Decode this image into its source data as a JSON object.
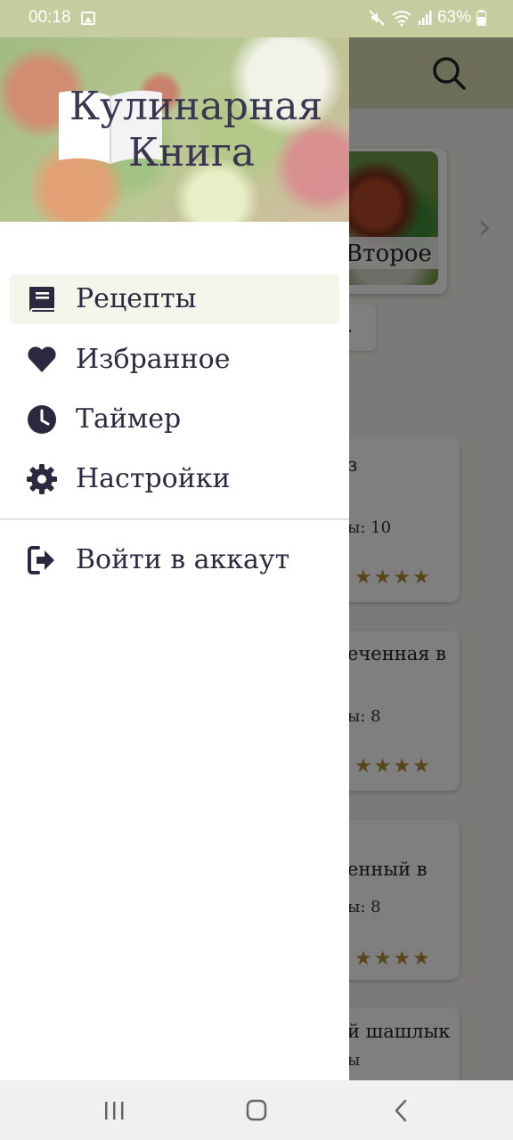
{
  "status_bar": {
    "time": "00:18",
    "battery": "63%",
    "icons": [
      "image-icon",
      "mute-icon",
      "wifi-icon",
      "signal-icon",
      "battery-icon"
    ]
  },
  "drawer": {
    "logo_line1": "Кулинарная",
    "logo_line2": "Книга",
    "items": [
      {
        "label": "Рецепты",
        "icon": "book-icon",
        "active": true
      },
      {
        "label": "Избранное",
        "icon": "heart-icon",
        "active": false
      },
      {
        "label": "Таймер",
        "icon": "clock-icon",
        "active": false
      },
      {
        "label": "Настройки",
        "icon": "gear-icon",
        "active": false
      }
    ],
    "login": {
      "label": "Войти в аккаут",
      "icon": "sign-in-icon"
    }
  },
  "background": {
    "category_label": "Второе",
    "ellipsis": ".",
    "recipes": [
      {
        "title": "з",
        "servings": "ы: 10",
        "stars": "★★★★"
      },
      {
        "title": "еченная в",
        "servings": "ы: 8",
        "stars": "★★★★"
      },
      {
        "title": "енный в",
        "servings": "ы: 8",
        "stars": "★★★★"
      },
      {
        "title": "й шашлык",
        "servings": "ы",
        "stars": ""
      }
    ]
  },
  "colors": {
    "status_bar": "#c7cca0",
    "header": "#d8dcb4",
    "text_dark": "#2b2940",
    "star": "#b08d3a",
    "active_item_bg": "#f6f5ec"
  },
  "nav_bar": {
    "icons": [
      "recent-apps-icon",
      "home-icon",
      "back-icon"
    ]
  }
}
